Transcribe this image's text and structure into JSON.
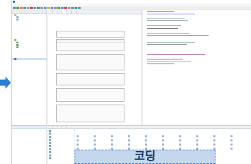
{
  "window": {
    "title": ""
  },
  "menu": [
    "",
    "",
    "",
    "",
    "",
    "",
    "",
    ""
  ],
  "toolbar": {
    "button_colors": [
      "#6a8fc7",
      "#3b9a4f",
      "#d98a2b",
      "#6a8fc7",
      "#999999",
      "#c24a4a",
      "#6a8fc7",
      "#3b9a4f",
      "#999999",
      "#6a8fc7",
      "#d9c12b",
      "#6a8fc7",
      "#999999",
      "#3b9a4f",
      "#6a8fc7",
      "#c24a4a",
      "#999999",
      "#6a8fc7",
      "#3b9a4f",
      "#6a8fc7"
    ]
  },
  "package_explorer": {
    "tab_label": ""
  },
  "editor": {
    "tabs": [
      "",
      "",
      "",
      "",
      "",
      ""
    ],
    "hint": ""
  },
  "code": {
    "lines_count_hint": ""
  },
  "bottom": {
    "tabs": [
      "",
      "",
      "",
      ""
    ],
    "palette_tabs": [
      "",
      "",
      "",
      "",
      ""
    ]
  },
  "overlay": {
    "code_label": "코딩",
    "arrow_color": "#2a7fd4",
    "label_bg": "#bad0e9",
    "label_border": "#2f6ea9"
  }
}
